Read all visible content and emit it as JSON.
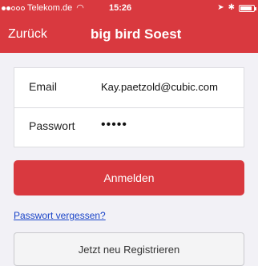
{
  "status_bar": {
    "carrier": "Telekom.de",
    "time": "15:26",
    "wifi_icon": "wifi-icon",
    "location_icon": "location-arrow-icon",
    "bluetooth_icon": "bluetooth-icon",
    "battery_icon": "battery-icon"
  },
  "nav": {
    "back_label": "Zurück",
    "title": "big bird Soest"
  },
  "form": {
    "email_label": "Email",
    "email_value": "Kay.paetzold@cubic.com",
    "password_label": "Passwort",
    "password_value": "•••••"
  },
  "actions": {
    "login_label": "Anmelden",
    "forgot_label": "Passwort vergessen?",
    "register_label": "Jetzt neu Registrieren"
  },
  "colors": {
    "brand_red": "#d9393f",
    "link_blue": "#1a44c8",
    "background": "#f2f1f6"
  }
}
